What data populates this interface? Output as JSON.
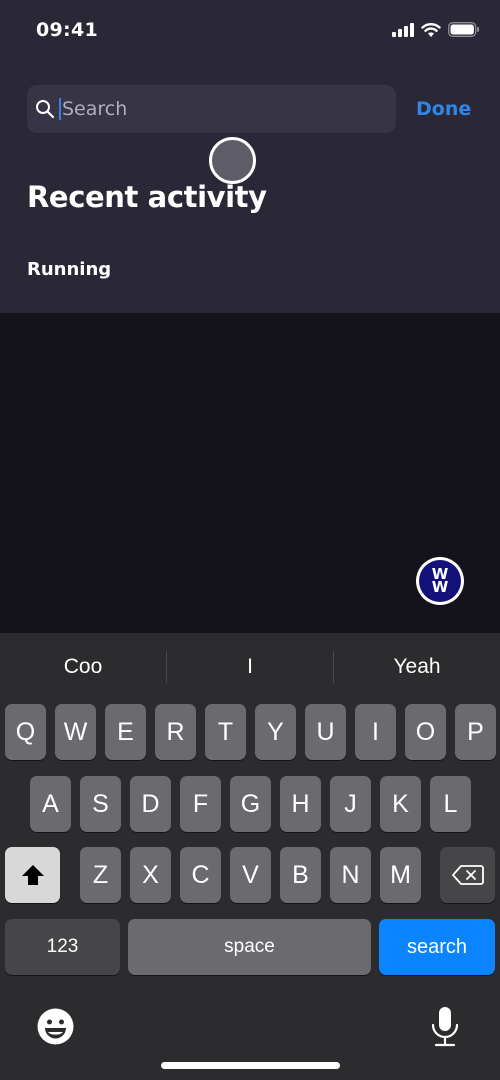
{
  "status_bar": {
    "time": "09:41",
    "icons": [
      "cellular-signal-icon",
      "wifi-icon",
      "battery-icon"
    ]
  },
  "search": {
    "placeholder": "Search",
    "value": "",
    "icon": "search-icon",
    "done_label": "Done"
  },
  "content": {
    "section_title": "Recent activity",
    "items": [
      {
        "label": "Running"
      }
    ]
  },
  "logo": {
    "text_top": "W",
    "text_bottom": "W",
    "name": "WW"
  },
  "keyboard": {
    "suggestions": [
      "Coo",
      "I",
      "Yeah"
    ],
    "row1": [
      "Q",
      "W",
      "E",
      "R",
      "T",
      "Y",
      "U",
      "I",
      "O",
      "P"
    ],
    "row2": [
      "A",
      "S",
      "D",
      "F",
      "G",
      "H",
      "J",
      "K",
      "L"
    ],
    "row3": [
      "Z",
      "X",
      "C",
      "V",
      "B",
      "N",
      "M"
    ],
    "numbers_label": "123",
    "space_label": "space",
    "search_label": "search",
    "shift_icon": "shift-icon",
    "delete_icon": "backspace-icon",
    "emoji_icon": "emoji-icon",
    "mic_icon": "microphone-icon"
  },
  "colors": {
    "accent": "#2f86e6",
    "search_key": "#0a84ff",
    "panel": "#2a2836",
    "logo_blue": "#14127a"
  }
}
